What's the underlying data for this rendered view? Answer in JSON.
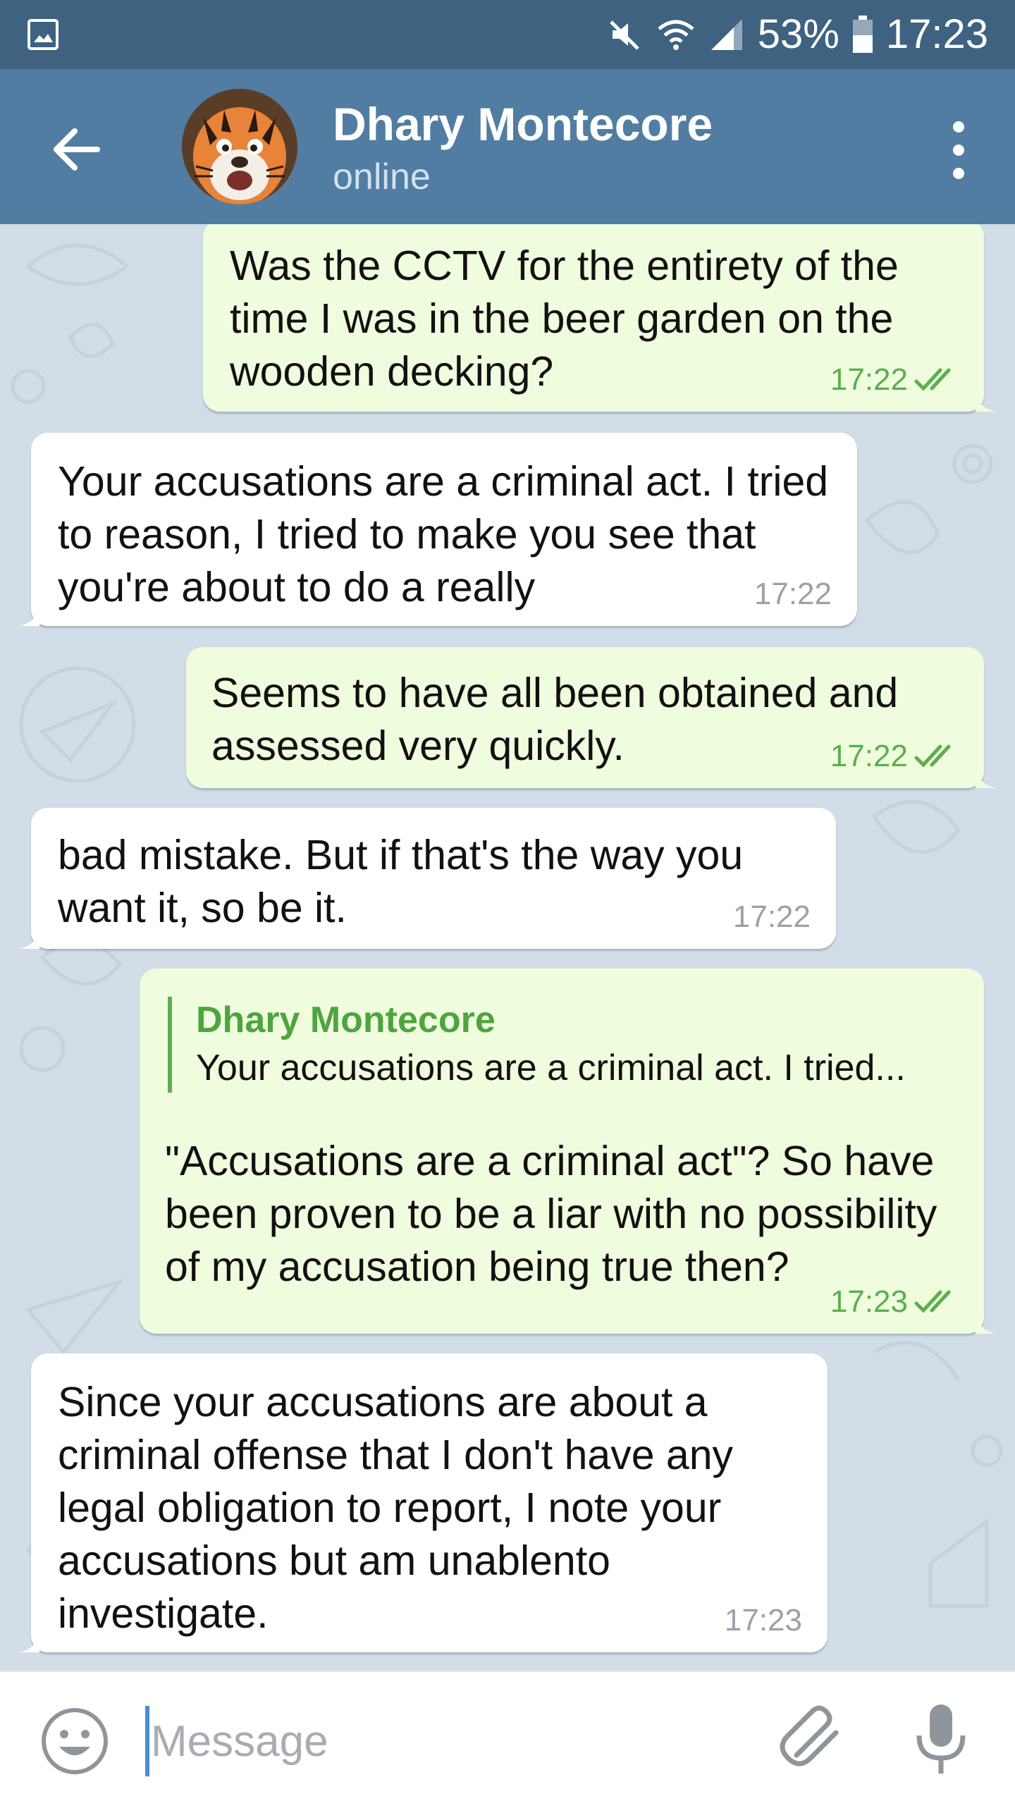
{
  "status_bar": {
    "battery": "53%",
    "time": "17:23",
    "icons": [
      "gallery-icon",
      "mute-icon",
      "wifi-icon",
      "signal-icon",
      "battery-icon"
    ]
  },
  "header": {
    "name": "Dhary Montecore",
    "status": "online",
    "icons": [
      "back-arrow-icon",
      "tiger-avatar",
      "more-vert-icon"
    ]
  },
  "messages": [
    {
      "direction": "out",
      "text": "Was the CCTV for the entirety of the time I was in the beer garden on the wooden decking?",
      "time": "17:22",
      "read": true
    },
    {
      "direction": "in",
      "text": "Your accusations are a criminal act. I tried to reason, I tried to make you see that you're about to do a really",
      "time": "17:22"
    },
    {
      "direction": "out",
      "text": "Seems to have all been obtained and assessed very quickly.",
      "time": "17:22",
      "read": true
    },
    {
      "direction": "in",
      "text": "bad mistake. But if that's the way you want it, so be it.",
      "time": "17:22"
    },
    {
      "direction": "out",
      "reply": {
        "name": "Dhary Montecore",
        "text": "Your accusations are a criminal act. I tried..."
      },
      "text": "\"Accusations are a criminal act\"? So have been proven to be a liar with no possibility of my accusation being true then?",
      "time": "17:23",
      "read": true
    },
    {
      "direction": "in",
      "text": "Since your accusations are about a criminal offense that I don't have any legal obligation to report, I note your accusations but am unablento investigate.",
      "time": "17:23"
    }
  ],
  "input_bar": {
    "placeholder": "Message",
    "icons": [
      "emoji-icon",
      "attach-icon",
      "mic-icon"
    ]
  },
  "colors": {
    "status_bar": "#3e6280",
    "header": "#517da2",
    "outgoing_bubble": "#effdde",
    "incoming_bubble": "#ffffff",
    "check_green": "#5cae4e",
    "wallpaper": "#d3dde7"
  }
}
